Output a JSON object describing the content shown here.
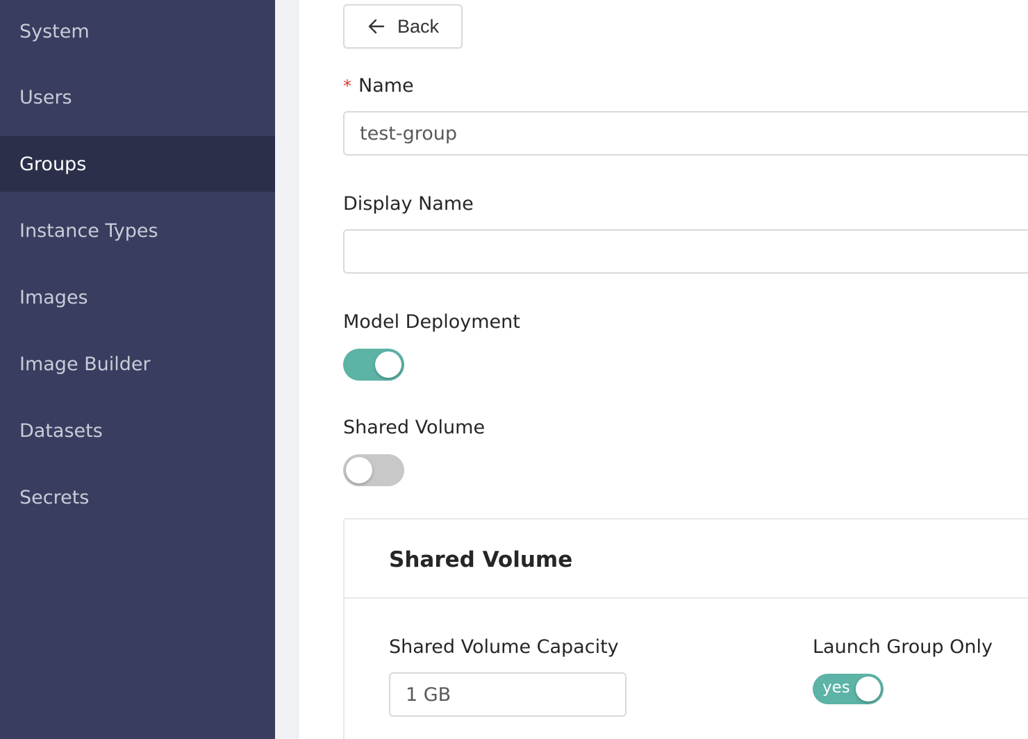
{
  "sidebar": {
    "items": [
      {
        "label": "System"
      },
      {
        "label": "Users"
      },
      {
        "label": "Groups",
        "active": true
      },
      {
        "label": "Instance Types"
      },
      {
        "label": "Images"
      },
      {
        "label": "Image Builder"
      },
      {
        "label": "Datasets"
      },
      {
        "label": "Secrets"
      }
    ]
  },
  "form": {
    "back_label": "Back",
    "name": {
      "label": "Name",
      "required_mark": "*",
      "value": "test-group"
    },
    "display_name": {
      "label": "Display Name",
      "value": ""
    },
    "model_deployment": {
      "label": "Model Deployment",
      "enabled": true
    },
    "shared_volume_toggle": {
      "label": "Shared Volume",
      "enabled": false
    }
  },
  "shared_volume_card": {
    "title": "Shared Volume",
    "capacity": {
      "label": "Shared Volume Capacity",
      "value": "1 GB"
    },
    "launch_group_only": {
      "label": "Launch Group Only",
      "switch_text": "yes",
      "enabled": true
    }
  },
  "colors": {
    "sidebar_bg": "#393e60",
    "sidebar_active_bg": "#2b2f4a",
    "switch_on": "#5cb3a6",
    "switch_off": "#c8c8c8",
    "required": "#e53935"
  },
  "icons": {
    "back": "arrow-left-icon"
  }
}
